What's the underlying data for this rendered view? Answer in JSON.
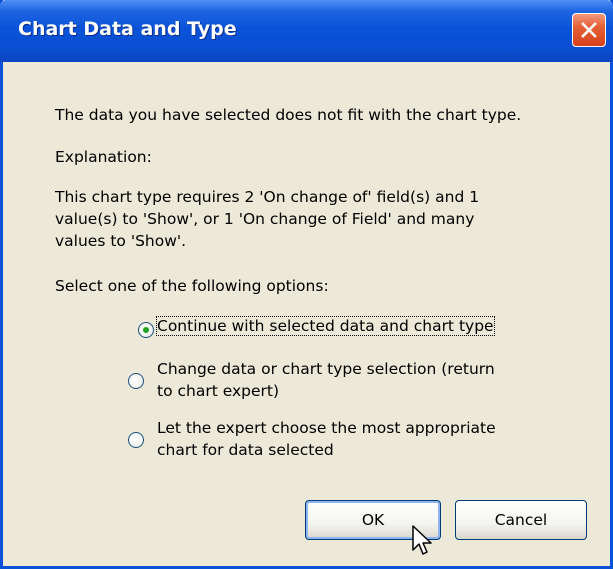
{
  "dialog": {
    "title": "Chart Data and Type",
    "message": "The data you have selected does not fit with the chart type.",
    "explanation_heading": "Explanation:",
    "explanation_lines": [
      "This chart type requires 2 'On change of' field(s) and  1",
      "value(s) to 'Show', or 1 'On change of Field' and many",
      "values to 'Show'."
    ],
    "options_prompt": "Select one of the following options:",
    "options": [
      {
        "lines": [
          "Continue with selected data and chart type"
        ],
        "selected": true
      },
      {
        "lines": [
          "Change data or chart type selection (return",
          "to chart expert)"
        ],
        "selected": false
      },
      {
        "lines": [
          "Let the expert choose the most appropriate",
          "chart for data selected"
        ],
        "selected": false
      }
    ],
    "ok_label": "OK",
    "cancel_label": "Cancel"
  },
  "icons": [
    "close-icon",
    "mouse-pointer-icon"
  ],
  "colors": {
    "titlebar": "#0a53d8",
    "face": "#ece9d8",
    "close_button": "#e46034",
    "radio_dot": "#21a121"
  }
}
